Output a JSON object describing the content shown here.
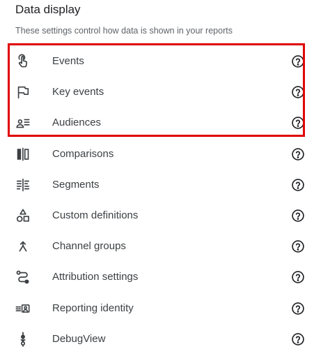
{
  "section": {
    "title": "Data display",
    "subtitle": "These settings control how data is shown in your reports",
    "highlight_color": "#e00000"
  },
  "items": [
    {
      "label": "Events",
      "icon": "touch-icon"
    },
    {
      "label": "Key events",
      "icon": "flag-icon"
    },
    {
      "label": "Audiences",
      "icon": "audience-icon"
    },
    {
      "label": "Comparisons",
      "icon": "comparisons-icon"
    },
    {
      "label": "Segments",
      "icon": "segments-icon"
    },
    {
      "label": "Custom definitions",
      "icon": "shapes-icon"
    },
    {
      "label": "Channel groups",
      "icon": "merge-icon"
    },
    {
      "label": "Attribution settings",
      "icon": "route-icon"
    },
    {
      "label": "Reporting identity",
      "icon": "identity-icon"
    },
    {
      "label": "DebugView",
      "icon": "debug-icon"
    }
  ]
}
